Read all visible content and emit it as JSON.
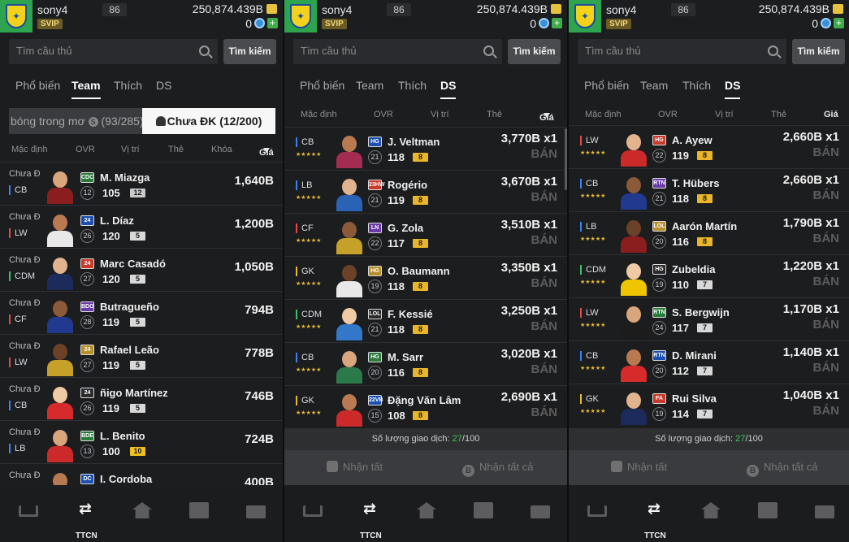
{
  "header": {
    "logo": "club-crest-icon",
    "username": "sony4",
    "level": "86",
    "svip": "SVIP",
    "coins": "250,874.439B",
    "cash": "0"
  },
  "search": {
    "placeholder": "Tìm cầu thủ",
    "button": "Tìm kiếm"
  },
  "tabs": [
    "Phổ biến",
    "Team",
    "Thích",
    "DS"
  ],
  "panel1": {
    "active_tab": "Team",
    "seg_left": "bóng trong mơ",
    "seg_left_icon": "S",
    "seg_left_count": "(93/285)",
    "seg_right": "Chưa ĐK (12/200)",
    "columns": [
      "Mặc định",
      "OVR",
      "Vị trí",
      "Thẻ",
      "Khóa",
      "Giá"
    ],
    "rows": [
      {
        "status": "Chưa Đ",
        "pos": "CB",
        "club": "CDC",
        "name": "M. Miazga",
        "grade": "12",
        "ovr": "105",
        "lv": "12",
        "price": "1,640B"
      },
      {
        "status": "Chưa Đ",
        "pos": "LW",
        "club": "24",
        "name": "L. Díaz",
        "grade": "26",
        "ovr": "120",
        "lv": "5",
        "price": "1,200B"
      },
      {
        "status": "Chưa Đ",
        "pos": "CDM",
        "club": "24",
        "name": "Marc Casadó",
        "grade": "27",
        "ovr": "120",
        "lv": "5",
        "price": "1,050B"
      },
      {
        "status": "Chưa Đ",
        "pos": "CF",
        "club": "BDO",
        "name": "Butragueño",
        "grade": "28",
        "ovr": "119",
        "lv": "5",
        "price": "794B"
      },
      {
        "status": "Chưa Đ",
        "pos": "LW",
        "club": "24",
        "name": "Rafael Leão",
        "grade": "27",
        "ovr": "119",
        "lv": "5",
        "price": "778B"
      },
      {
        "status": "Chưa Đ",
        "pos": "CB",
        "club": "24",
        "name": "ñigo Martínez",
        "grade": "26",
        "ovr": "119",
        "lv": "5",
        "price": "746B"
      },
      {
        "status": "Chưa Đ",
        "pos": "LB",
        "club": "BDE",
        "name": "L. Benito",
        "grade": "13",
        "ovr": "100",
        "lv": "10",
        "price": "724B"
      },
      {
        "status": "Chưa Đ",
        "pos": "CB",
        "club": "DC",
        "name": "I. Cordoba",
        "grade": "",
        "ovr": "",
        "lv": "",
        "price": "400B"
      }
    ]
  },
  "panel2": {
    "active_tab": "DS",
    "columns": [
      "Mặc định",
      "OVR",
      "Vị trí",
      "Thẻ",
      "Giá"
    ],
    "rows": [
      {
        "pos": "CB",
        "club": "HG",
        "name": "J. Veltman",
        "grade": "21",
        "ovr": "118",
        "lv": "8",
        "price": "3,770B x1",
        "action": "BÁN"
      },
      {
        "pos": "LB",
        "club": "23HW",
        "name": "Rogério",
        "grade": "21",
        "ovr": "119",
        "lv": "8",
        "price": "3,670B x1",
        "action": "BÁN"
      },
      {
        "pos": "CF",
        "club": "LN",
        "name": "G. Zola",
        "grade": "22",
        "ovr": "117",
        "lv": "8",
        "price": "3,510B x1",
        "action": "BÁN"
      },
      {
        "pos": "GK",
        "club": "HG",
        "name": "O. Baumann",
        "grade": "19",
        "ovr": "118",
        "lv": "8",
        "price": "3,350B x1",
        "action": "BÁN"
      },
      {
        "pos": "CDM",
        "club": "LOL",
        "name": "F. Kessié",
        "grade": "21",
        "ovr": "118",
        "lv": "8",
        "price": "3,250B x1",
        "action": "BÁN"
      },
      {
        "pos": "CB",
        "club": "HG",
        "name": "M. Sarr",
        "grade": "20",
        "ovr": "116",
        "lv": "8",
        "price": "3,020B x1",
        "action": "BÁN"
      },
      {
        "pos": "GK",
        "club": "22VB",
        "name": "Đặng Văn Lâm",
        "grade": "15",
        "ovr": "108",
        "lv": "8",
        "price": "2,690B x1",
        "action": "BÁN"
      }
    ]
  },
  "panel3": {
    "active_tab": "DS",
    "columns": [
      "Mặc định",
      "OVR",
      "Vị trí",
      "Thẻ",
      "Giá"
    ],
    "rows": [
      {
        "pos": "LW",
        "club": "HG",
        "name": "A. Ayew",
        "grade": "22",
        "ovr": "119",
        "lv": "8",
        "price": "2,660B x1",
        "action": "BÁN"
      },
      {
        "pos": "CB",
        "club": "RTN",
        "name": "T. Hübers",
        "grade": "21",
        "ovr": "118",
        "lv": "8",
        "price": "2,660B x1",
        "action": "BÁN"
      },
      {
        "pos": "LB",
        "club": "LOL",
        "name": "Aarón Martín",
        "grade": "20",
        "ovr": "116",
        "lv": "8",
        "price": "1,790B x1",
        "action": "BÁN"
      },
      {
        "pos": "CDM",
        "club": "HG",
        "name": "Zubeldia",
        "grade": "19",
        "ovr": "110",
        "lv": "7",
        "price": "1,220B x1",
        "action": "BÁN"
      },
      {
        "pos": "LW",
        "club": "RTN",
        "name": "S. Bergwijn",
        "grade": "24",
        "ovr": "117",
        "lv": "7",
        "price": "1,170B x1",
        "action": "BÁN"
      },
      {
        "pos": "CB",
        "club": "RTN",
        "name": "D. Mirani",
        "grade": "20",
        "ovr": "112",
        "lv": "7",
        "price": "1,140B x1",
        "action": "BÁN"
      },
      {
        "pos": "GK",
        "club": "FA",
        "name": "Rui Silva",
        "grade": "19",
        "ovr": "114",
        "lv": "7",
        "price": "1,040B x1",
        "action": "BÁN"
      }
    ]
  },
  "trade": {
    "label": "Số lượng giao dịch:",
    "used": "27",
    "total": "/100"
  },
  "claim": {
    "claim_all": "Nhận tất",
    "claim_all_b": "Nhận tất cả"
  },
  "nav": {
    "ttcn": "TTCN"
  }
}
